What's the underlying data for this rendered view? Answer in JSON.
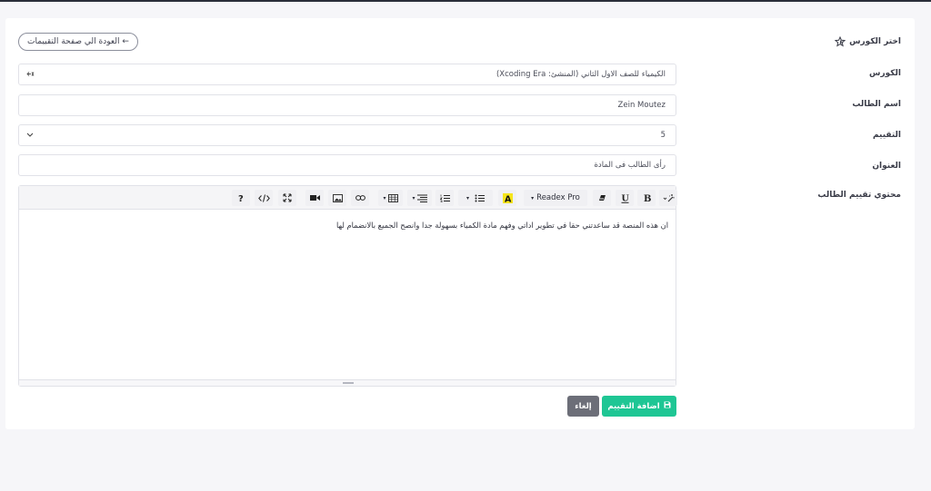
{
  "form": {
    "course_label": "اختر الكورس",
    "back_button": "← العودة الي صفحة التقييمات",
    "fields": [
      {
        "label": "الكورس",
        "value": "الكيمياء للصف الاول الثاني (المنشئ: Xcoding Era)",
        "icon": "clear-icon"
      },
      {
        "label": "اسم الطالب",
        "value": "Zein Moutez"
      },
      {
        "label": "التقييم",
        "value": "5",
        "icon": "chevron-down-icon"
      },
      {
        "label": "العنوان",
        "value": "رأى الطالب فى المادة"
      },
      {
        "label": "محتوي تقييم الطالب"
      }
    ]
  },
  "editor": {
    "font_name": "Readex Pro",
    "content": "ان هذه المنصة قد ساعدتني حقا في تطوير اداتي وفهم مادة الكمياء بسهولة جدا وانصح الجميع بالانضمام لها",
    "toolbar_icons": [
      "magic-icon",
      "bold-icon",
      "underline-icon",
      "eraser-icon",
      "font-icon",
      "highlight-icon",
      "unordered-list-icon",
      "ordered-list-icon",
      "align-icon",
      "table-icon",
      "link-icon",
      "image-icon",
      "video-icon",
      "fullscreen-icon",
      "code-icon",
      "help-icon"
    ]
  },
  "actions": {
    "submit_label": "اضافة التقييم",
    "cancel_label": "إلغاء"
  },
  "colors": {
    "primary": "#1ec694",
    "secondary": "#6c6e78",
    "background": "#f6f6f9",
    "topbar": "#2a2e3a"
  }
}
